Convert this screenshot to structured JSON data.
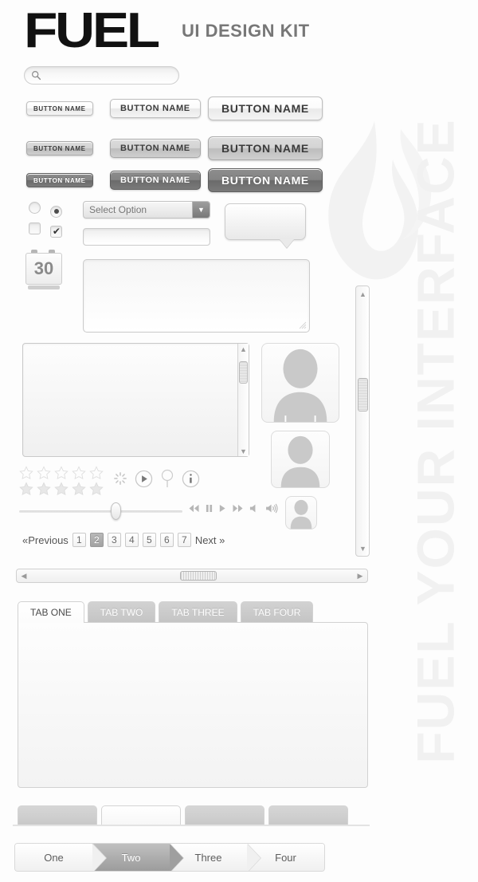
{
  "brand": {
    "logo": "FUEL",
    "kit_title": "UI DESIGN KIT",
    "side_wordmark": "FUEL YOUR INTERFACE",
    "watermark_icon": "flame-icon",
    "accent_dark": "#111111",
    "accent_gray": "#777777",
    "watermark_color": "#f1f1f1"
  },
  "search": {
    "icon": "search-icon",
    "value": "",
    "placeholder": ""
  },
  "buttons": {
    "label": "BUTTON NAME",
    "rows": [
      {
        "style": "light",
        "sizes": [
          "sm",
          "md",
          "lg"
        ]
      },
      {
        "style": "mid",
        "sizes": [
          "sm",
          "md",
          "lg"
        ]
      },
      {
        "style": "dark",
        "sizes": [
          "sm",
          "md",
          "lg"
        ]
      }
    ]
  },
  "form": {
    "radio_off_label": "radio-unselected",
    "radio_on_label": "radio-selected",
    "checkbox_off_label": "checkbox-unchecked",
    "checkbox_on_label": "checkbox-checked",
    "checkbox_tick": "✔",
    "select": {
      "value": "Select Option",
      "arrow_icon": "chevron-down-icon",
      "arrow_glyph": "▼"
    },
    "text_input": {
      "value": "",
      "placeholder": ""
    },
    "textarea": {
      "value": "",
      "placeholder": ""
    },
    "tooltip": {
      "text": ""
    },
    "calendar": {
      "day": "30"
    }
  },
  "scroll": {
    "up_glyph": "▲",
    "down_glyph": "▼",
    "left_glyph": "◀",
    "right_glyph": "▶"
  },
  "avatars": [
    {
      "name": "avatar-large"
    },
    {
      "name": "avatar-medium"
    },
    {
      "name": "avatar-small"
    }
  ],
  "rating": {
    "empty_count": 5,
    "filled_count": 5
  },
  "icons": {
    "spinner": "loading-spinner-icon",
    "play": "play-circle-icon",
    "pin": "map-pin-icon",
    "info": "info-circle-icon"
  },
  "slider": {
    "value_percent": 56
  },
  "media": {
    "controls": [
      "rewind-icon",
      "pause-icon",
      "play-icon",
      "fast-forward-icon",
      "mute-icon",
      "volume-icon"
    ]
  },
  "pagination": {
    "previous": "«Previous",
    "next": "Next »",
    "pages": [
      "1",
      "2",
      "3",
      "4",
      "5",
      "6",
      "7"
    ],
    "active": "2"
  },
  "tabs": {
    "items": [
      "TAB ONE",
      "TAB TWO",
      "TAB THREE",
      "TAB FOUR"
    ],
    "active_index": 0,
    "panel_text": ""
  },
  "tab_stubs": {
    "count": 4,
    "active_index": 1
  },
  "breadcrumb": {
    "items": [
      "One",
      "Two",
      "Three",
      "Four"
    ],
    "active_index": 1
  }
}
